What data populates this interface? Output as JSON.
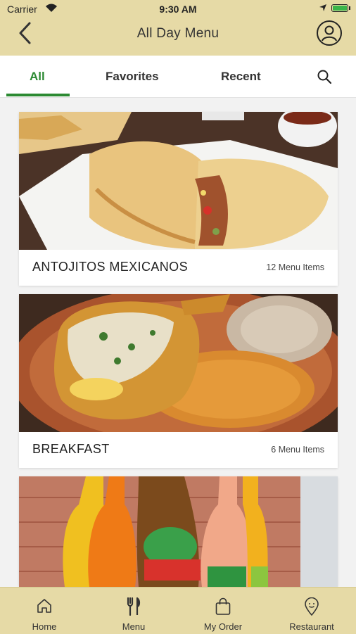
{
  "status": {
    "carrier": "Carrier",
    "time": "9:30 AM"
  },
  "header": {
    "title": "All Day Menu"
  },
  "tabs": [
    {
      "label": "All",
      "active": true
    },
    {
      "label": "Favorites",
      "active": false
    },
    {
      "label": "Recent",
      "active": false
    }
  ],
  "categories": [
    {
      "name": "ANTOJITOS MEXICANOS",
      "count": "12 Menu Items"
    },
    {
      "name": "BREAKFAST",
      "count": "6 Menu Items"
    }
  ],
  "nav": [
    {
      "label": "Home"
    },
    {
      "label": "Menu"
    },
    {
      "label": "My Order"
    },
    {
      "label": "Restaurant"
    }
  ],
  "colors": {
    "accent": "#2c8a33",
    "bar": "#e6daa6"
  }
}
